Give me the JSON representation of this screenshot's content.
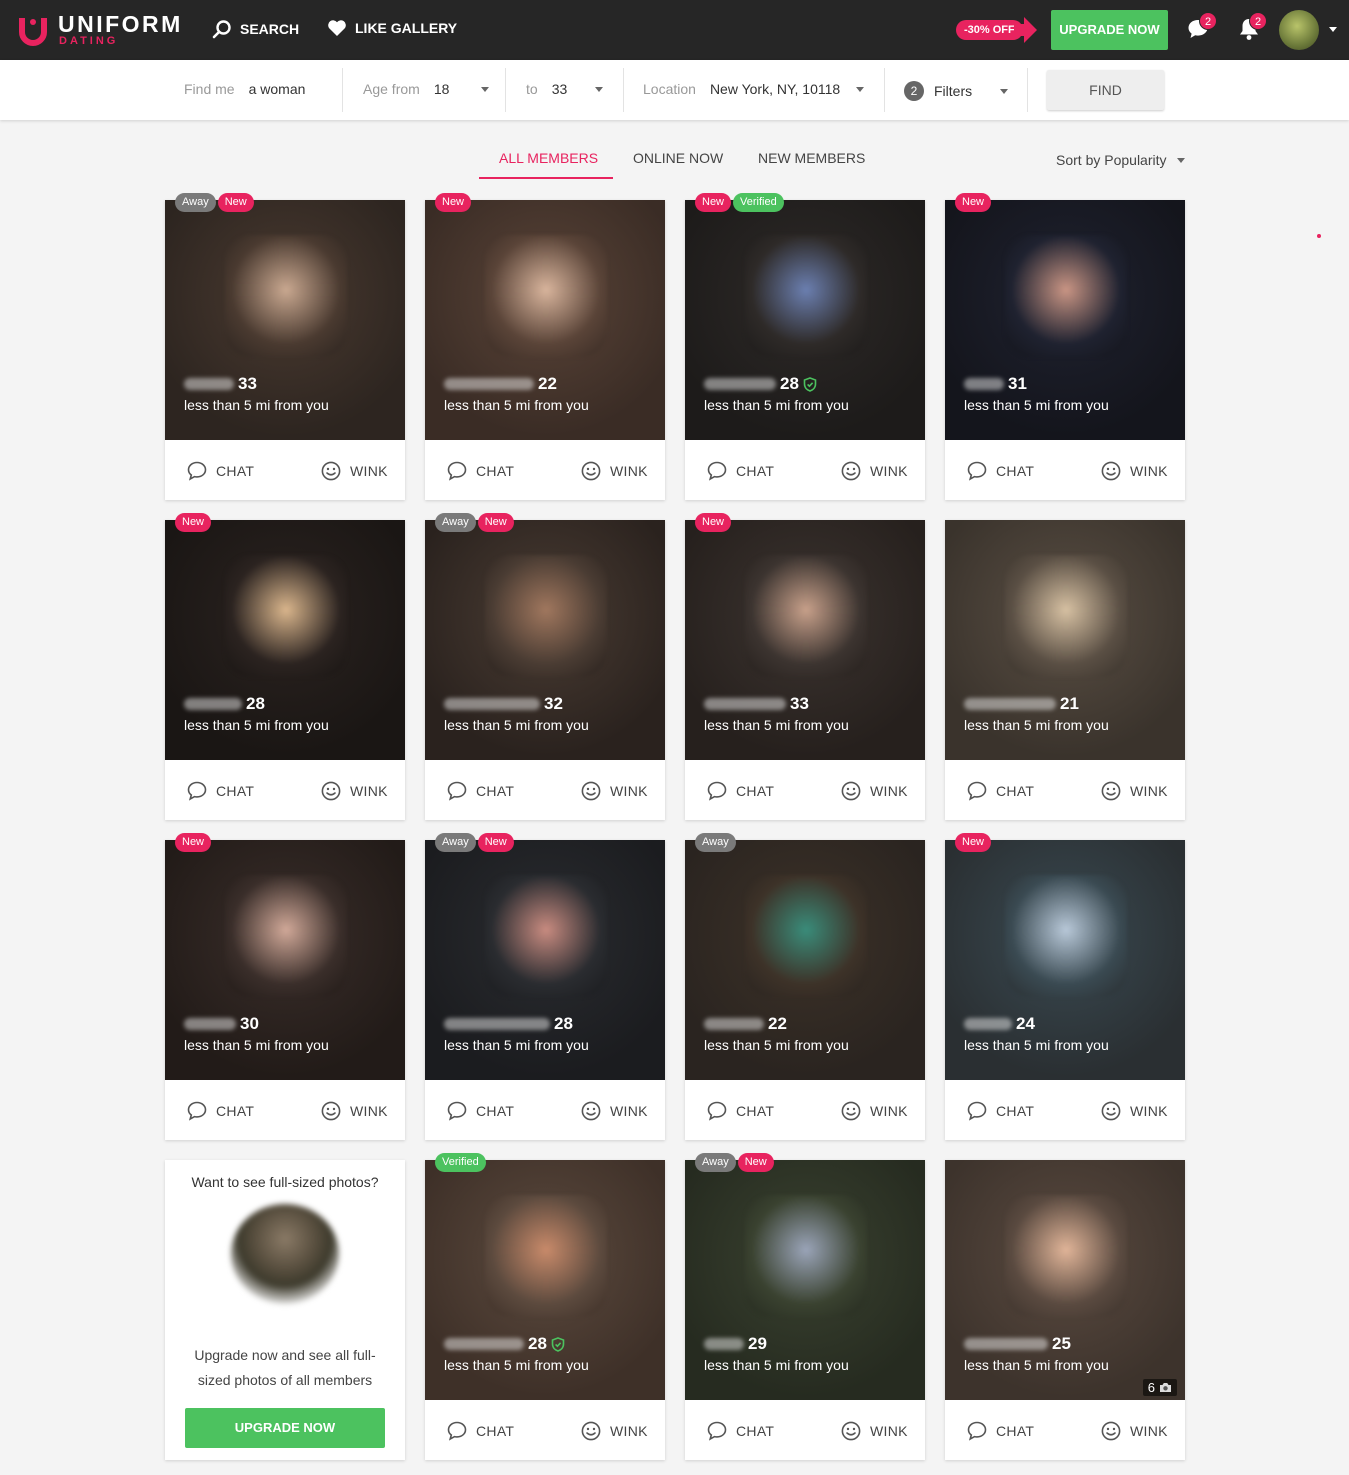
{
  "brand": {
    "name": "UNIFORM",
    "sub": "DATING"
  },
  "topnav": {
    "search": "SEARCH",
    "like_gallery": "LIKE GALLERY",
    "promo": "-30% OFF",
    "upgrade": "UPGRADE NOW",
    "messages_count": "2",
    "notifications_count": "2"
  },
  "searchbar": {
    "find_me_label": "Find me",
    "find_me_value": "a woman",
    "age_from_label": "Age from",
    "age_from_value": "18",
    "age_to_label": "to",
    "age_to_value": "33",
    "location_label": "Location",
    "location_value": "New York, NY, 10118",
    "filters_count": "2",
    "filters_label": "Filters",
    "find_button": "FIND"
  },
  "tabs": [
    {
      "label": "ALL MEMBERS",
      "active": true
    },
    {
      "label": "ONLINE NOW",
      "active": false
    },
    {
      "label": "NEW MEMBERS",
      "active": false
    }
  ],
  "sort_label": "Sort by Popularity",
  "colors": {
    "accent": "#e8235f",
    "green": "#4cc25f",
    "topbar": "#262626"
  },
  "card_actions": {
    "chat": "CHAT",
    "wink": "WINK"
  },
  "members": [
    {
      "age": "33",
      "distance": "less than 5 mi from you",
      "badges": [
        "Away",
        "New"
      ],
      "verified": false,
      "palette": [
        "#4a3a30",
        "#2d2520",
        "#c9a890"
      ]
    },
    {
      "age": "22",
      "distance": "less than 5 mi from you",
      "badges": [
        "New"
      ],
      "verified": false,
      "palette": [
        "#5a4438",
        "#3a2c25",
        "#d8b49c"
      ]
    },
    {
      "age": "28",
      "distance": "less than 5 mi from you",
      "badges": [
        "New",
        "Verified"
      ],
      "verified": true,
      "palette": [
        "#2e2a28",
        "#1d1b1a",
        "#6b7fb0"
      ]
    },
    {
      "age": "31",
      "distance": "less than 5 mi from you",
      "badges": [
        "New"
      ],
      "verified": false,
      "palette": [
        "#1f2230",
        "#14151c",
        "#c99584"
      ]
    },
    {
      "age": "28",
      "distance": "less than 5 mi from you",
      "badges": [
        "New"
      ],
      "verified": false,
      "palette": [
        "#2b2320",
        "#1a1614",
        "#d9b58c"
      ]
    },
    {
      "age": "32",
      "distance": "less than 5 mi from you",
      "badges": [
        "Away",
        "New"
      ],
      "verified": false,
      "palette": [
        "#4a3c33",
        "#2a221e",
        "#a0775e"
      ]
    },
    {
      "age": "33",
      "distance": "less than 5 mi from you",
      "badges": [
        "New"
      ],
      "verified": false,
      "palette": [
        "#3c3430",
        "#26201d",
        "#c7a08a"
      ]
    },
    {
      "age": "21",
      "distance": "less than 5 mi from you",
      "badges": [],
      "verified": false,
      "palette": [
        "#5a4f44",
        "#3a332c",
        "#d6c0a2"
      ]
    },
    {
      "age": "30",
      "distance": "less than 5 mi from you",
      "badges": [
        "New"
      ],
      "verified": false,
      "palette": [
        "#3a2e2a",
        "#221b18",
        "#d0a898"
      ]
    },
    {
      "age": "28",
      "distance": "less than 5 mi from you",
      "badges": [
        "Away",
        "New"
      ],
      "verified": false,
      "palette": [
        "#2a2c30",
        "#1b1c1f",
        "#c88b80"
      ]
    },
    {
      "age": "22",
      "distance": "less than 5 mi from you",
      "badges": [
        "Away"
      ],
      "verified": false,
      "palette": [
        "#3d3228",
        "#2a2420",
        "#3a8c7a"
      ]
    },
    {
      "age": "24",
      "distance": "less than 5 mi from you",
      "badges": [
        "New"
      ],
      "verified": false,
      "palette": [
        "#3a4a52",
        "#2a2f32",
        "#b8c8d8"
      ]
    },
    {
      "age": "28",
      "distance": "less than 5 mi from you",
      "badges": [
        "Verified"
      ],
      "verified": true,
      "palette": [
        "#5c4a3e",
        "#3e3028",
        "#c88a6a"
      ]
    },
    {
      "age": "29",
      "distance": "less than 5 mi from you",
      "badges": [
        "Away",
        "New"
      ],
      "verified": false,
      "palette": [
        "#3a4230",
        "#262b20",
        "#9aa4b8"
      ]
    },
    {
      "age": "25",
      "distance": "less than 5 mi from you",
      "badges": [],
      "verified": false,
      "photo_count": "6",
      "palette": [
        "#5a4a40",
        "#3d332c",
        "#e0b498"
      ]
    }
  ],
  "upsell": {
    "title": "Want to see full-sized photos?",
    "text": "Upgrade now and see all full-sized photos of all members",
    "button": "UPGRADE NOW"
  }
}
